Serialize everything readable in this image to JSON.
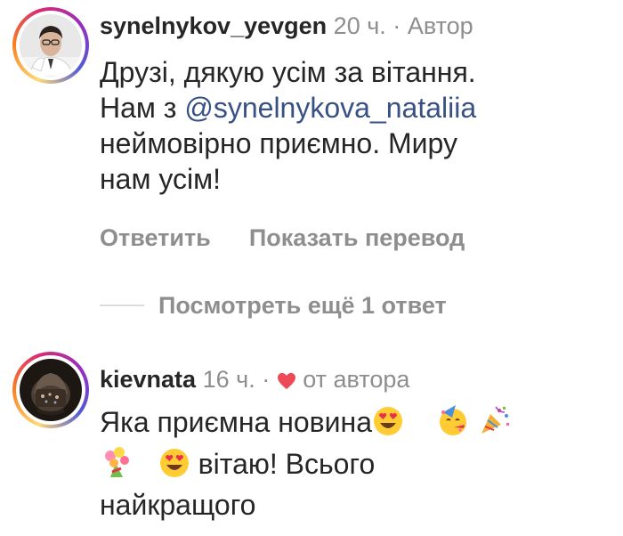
{
  "comments": [
    {
      "username": "synelnykov_yevgen",
      "time": "20 ч.",
      "separator": "·",
      "role": "Автор",
      "text_line_1": "Друзі, дякую усім за вітання.",
      "text_line_2_prefix": "Нам з ",
      "mention": "@synelnykova_nataliia",
      "text_line_3": "неймовірно приємно. Миру",
      "text_line_4": "нам усім!",
      "reply_label": "Ответить",
      "translate_label": "Показать перевод"
    },
    {
      "username": "kievnata",
      "time": "16 ч.",
      "separator": "·",
      "from_author": "от автора",
      "text_line_1": "Яка приємна новина",
      "text_line_2": "вітаю! Всього",
      "text_line_3": "найкращого"
    }
  ],
  "more_replies_label": "Посмотреть ещё 1 ответ",
  "icons": {
    "heart": "heart-icon",
    "heart_eyes": "heart-eyes-emoji",
    "partying_face": "partying-face-emoji",
    "party_popper": "party-popper-emoji",
    "bouquet": "bouquet-emoji"
  },
  "colors": {
    "text": "#262626",
    "muted": "#8e8e8e",
    "mention": "#385185",
    "heart": "#ed4956"
  }
}
